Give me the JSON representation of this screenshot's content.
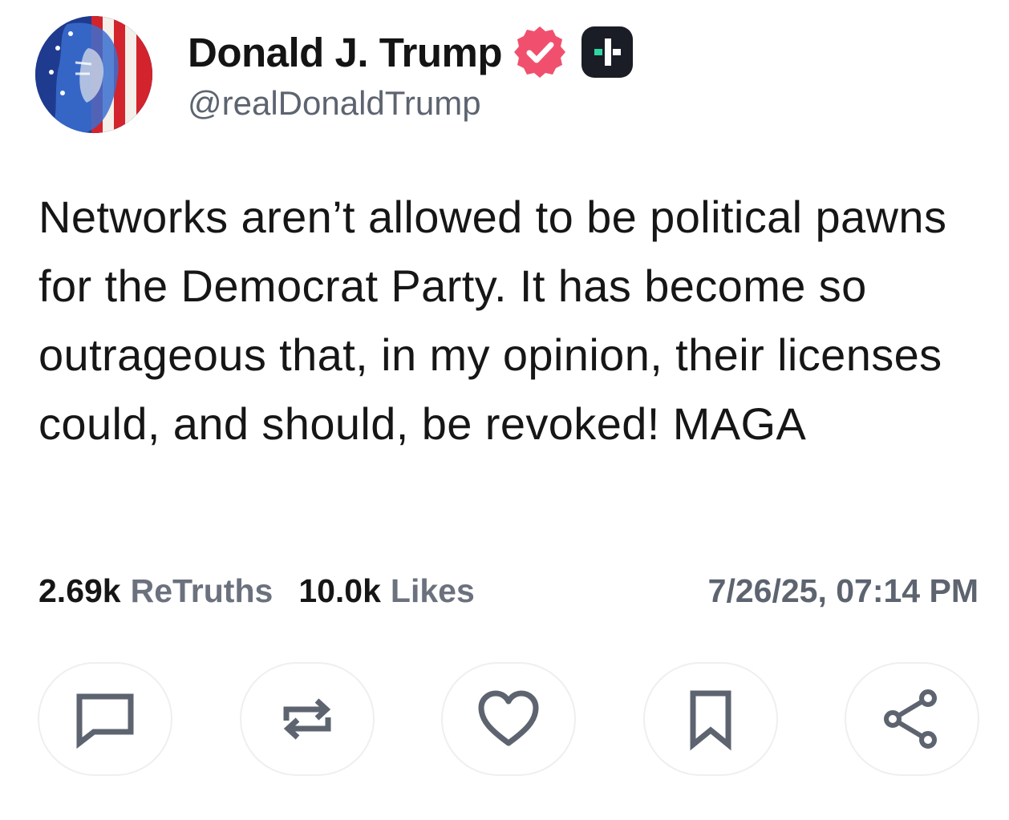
{
  "author": {
    "display_name": "Donald J. Trump",
    "handle": "@realDonaldTrump",
    "avatar_icon": "avatar-flag-portrait",
    "verified_icon": "verified-badge-icon",
    "plus_icon": "plus-badge-icon"
  },
  "post": {
    "text": "Networks aren’t allowed to be political pawns for the Democrat Party. It has become so outrageous that, in my opinion, their licenses could, and should, be revoked! MAGA"
  },
  "stats": {
    "retruths_count": "2.69k",
    "retruths_label": "ReTruths",
    "likes_count": "10.0k",
    "likes_label": "Likes",
    "timestamp": "7/26/25, 07:14 PM"
  },
  "actions": [
    {
      "icon": "reply-icon"
    },
    {
      "icon": "retruth-icon"
    },
    {
      "icon": "heart-icon"
    },
    {
      "icon": "bookmark-icon"
    },
    {
      "icon": "share-icon"
    }
  ],
  "colors": {
    "verified": "#f0506e",
    "plus_badge_bg": "#1a1d26",
    "plus_badge_accent": "#2fd6a3",
    "icon_stroke": "#5d6470",
    "button_border": "#efeff2"
  }
}
